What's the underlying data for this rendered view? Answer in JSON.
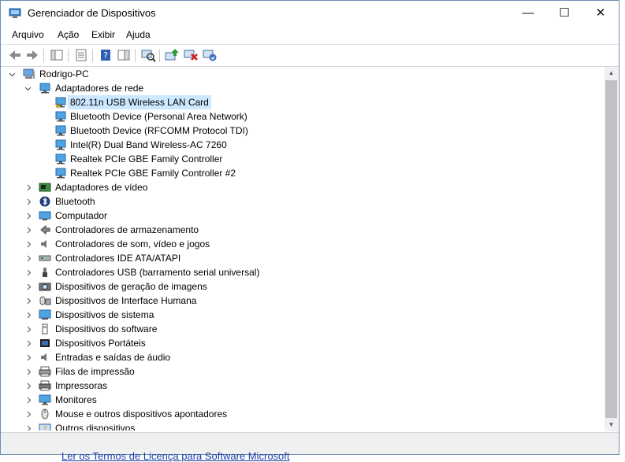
{
  "window": {
    "title": "Gerenciador de Dispositivos",
    "buttons": {
      "minimize": "—",
      "maximize": "☐",
      "close": "✕"
    }
  },
  "menu": [
    "Arquivo",
    "Ação",
    "Exibir",
    "Ajuda"
  ],
  "toolbar": [
    "back-icon",
    "forward-icon",
    "show-hide-console-tree-icon",
    "properties-icon",
    "help-icon",
    "action-pane-icon",
    "scan-hardware-icon",
    "update-driver-icon",
    "disable-device-icon",
    "uninstall-device-icon"
  ],
  "tree": {
    "root": "Rodrigo-PC",
    "network": {
      "label": "Adaptadores de rede",
      "children": [
        "802.11n USB Wireless LAN Card",
        "Bluetooth Device (Personal Area Network)",
        "Bluetooth Device (RFCOMM Protocol TDI)",
        "Intel(R) Dual Band Wireless-AC 7260",
        "Realtek PCIe GBE Family Controller",
        "Realtek PCIe GBE Family Controller #2"
      ]
    },
    "categories": [
      "Adaptadores de vídeo",
      "Bluetooth",
      "Computador",
      "Controladores de armazenamento",
      "Controladores de som, vídeo e jogos",
      "Controladores IDE ATA/ATAPI",
      "Controladores USB (barramento serial universal)",
      "Dispositivos de geração de imagens",
      "Dispositivos de Interface Humana",
      "Dispositivos de sistema",
      "Dispositivos do software",
      "Dispositivos Portáteis",
      "Entradas e saídas de áudio",
      "Filas de impressão",
      "Impressoras",
      "Monitores",
      "Mouse e outros dispositivos apontadores",
      "Outros dispositivos"
    ]
  },
  "background_link": "Ler os Termos de Licença para Software Microsoft"
}
